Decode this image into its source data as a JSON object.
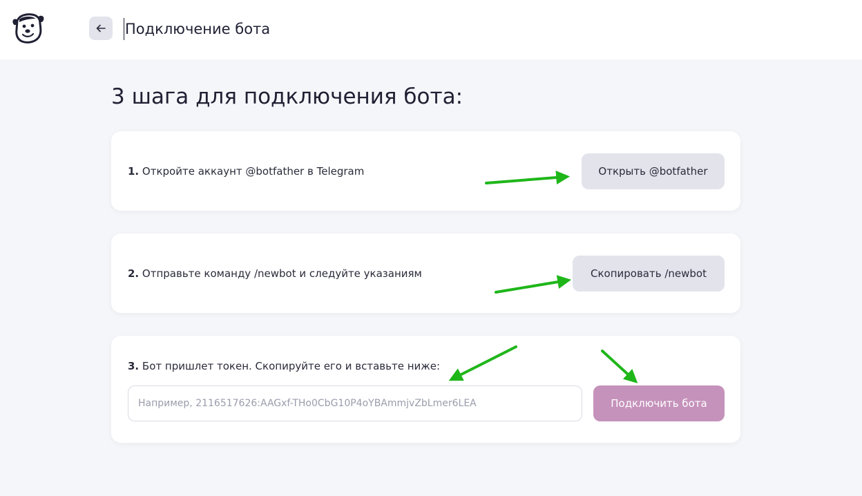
{
  "header": {
    "title": "Подключение бота",
    "back_icon": "arrow-left-icon",
    "logo_icon": "dog-mascot-icon"
  },
  "main": {
    "title": "3 шага для подключения бота:"
  },
  "steps": [
    {
      "number": "1.",
      "text": " Откройте аккаунт @botfather в Telegram",
      "button_label": "Открыть @botfather"
    },
    {
      "number": "2.",
      "text": " Отправьте команду /newbot и следуйте указаниям",
      "button_label": "Скопировать /newbot"
    },
    {
      "number": "3.",
      "text": " Бот пришлет токен. Скопируйте его и вставьте ниже:",
      "input_value": "",
      "input_placeholder": "Например, 2116517626:AAGxf-THo0CbG10P4oYBAmmjvZbLmer6LEA",
      "button_label": "Подключить бота"
    }
  ],
  "colors": {
    "accent_button": "#c592bb",
    "grey_button": "#e2e3eb",
    "background": "#f5f6f9",
    "annotation_arrow": "#1fb61a"
  }
}
